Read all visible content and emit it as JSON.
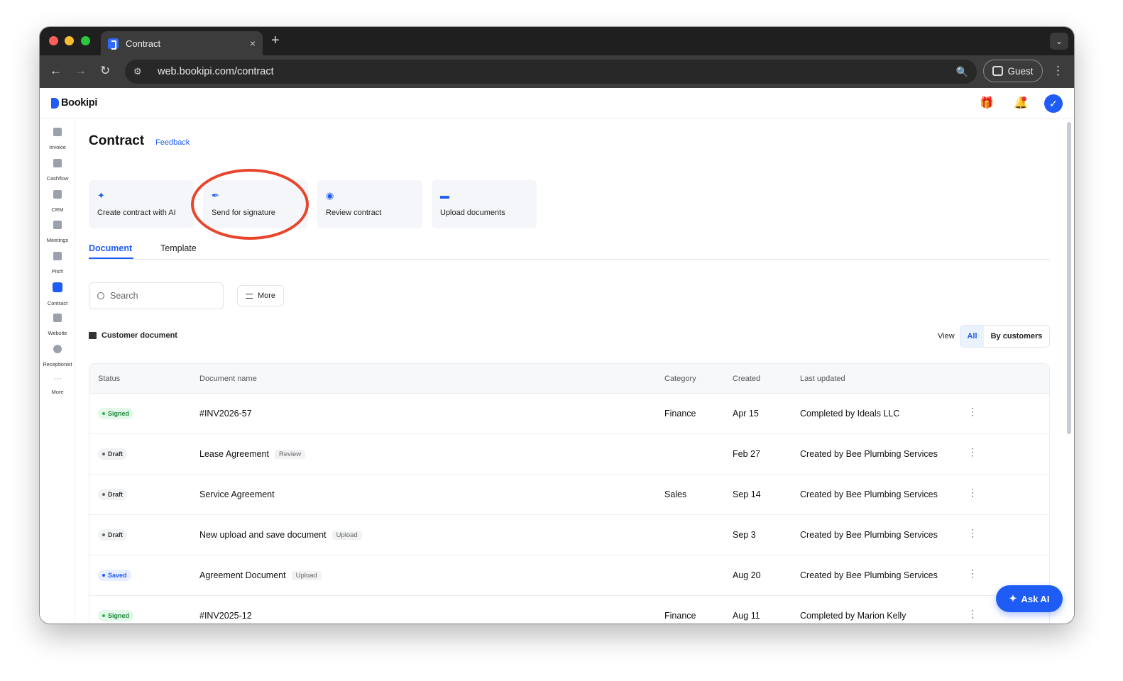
{
  "browser": {
    "tab_title": "Contract",
    "tab_close": "×",
    "new_tab": "+",
    "tab_menu": "⌄",
    "url": "web.bookipi.com/contract",
    "profile_label": "Guest",
    "nav_back": "←",
    "nav_forward": "→",
    "nav_reload": "↻",
    "menu_icon": "⋮",
    "zoom_icon": "🔍",
    "site_icon": "⚙"
  },
  "app": {
    "logo_text": "Bookipi",
    "gift_icon": "🎁",
    "bell_icon": "🔔",
    "avatar_icon": "✓"
  },
  "sidebar": {
    "items": [
      {
        "label": "Invoice"
      },
      {
        "label": "Cashflow"
      },
      {
        "label": "CRM"
      },
      {
        "label": "Meetings"
      },
      {
        "label": "Pitch"
      },
      {
        "label": "Contract"
      },
      {
        "label": "Website"
      },
      {
        "label": "Receptionist"
      },
      {
        "label": "More"
      }
    ],
    "more_icon": "···"
  },
  "page": {
    "title": "Contract",
    "feedback_label": "Feedback"
  },
  "actions": [
    {
      "label": "Create contract with AI",
      "icon": "✦"
    },
    {
      "label": "Send for signature",
      "icon": "✒"
    },
    {
      "label": "Review contract",
      "icon": "◉"
    },
    {
      "label": "Upload documents",
      "icon": "▬"
    }
  ],
  "tabs": [
    {
      "label": "Document",
      "active": true
    },
    {
      "label": "Template",
      "active": false
    }
  ],
  "search": {
    "placeholder": "Search"
  },
  "filter": {
    "more_label": "More"
  },
  "section": {
    "title": "Customer document"
  },
  "view": {
    "label": "View",
    "options": [
      "All",
      "By customers"
    ],
    "selected": "All"
  },
  "table": {
    "columns": [
      "Status",
      "Document name",
      "Category",
      "Created",
      "Last updated"
    ],
    "rows": [
      {
        "status": "Signed",
        "name": "#INV2026-57",
        "tag": "",
        "category": "Finance",
        "created": "Apr 15",
        "updated": "Completed by Ideals LLC"
      },
      {
        "status": "Draft",
        "name": "Lease Agreement",
        "tag": "Review",
        "category": "",
        "created": "Feb 27",
        "updated": "Created by Bee Plumbing Services"
      },
      {
        "status": "Draft",
        "name": "Service Agreement",
        "tag": "",
        "category": "Sales",
        "created": "Sep 14",
        "updated": "Created by Bee Plumbing Services"
      },
      {
        "status": "Draft",
        "name": "New upload and save document",
        "tag": "Upload",
        "category": "",
        "created": "Sep 3",
        "updated": "Created by Bee Plumbing Services"
      },
      {
        "status": "Saved",
        "name": "Agreement Document",
        "tag": "Upload",
        "category": "",
        "created": "Aug 20",
        "updated": "Created by Bee Plumbing Services"
      },
      {
        "status": "Signed",
        "name": "#INV2025-12",
        "tag": "",
        "category": "Finance",
        "created": "Aug 11",
        "updated": "Completed by Marion Kelly"
      }
    ],
    "row_menu_icon": "⋮"
  },
  "ask_ai": {
    "label": "Ask AI",
    "icon": "✦"
  },
  "colors": {
    "accent": "#1f5cf5",
    "highlight": "#e8452c",
    "signed": "#27b24a"
  }
}
